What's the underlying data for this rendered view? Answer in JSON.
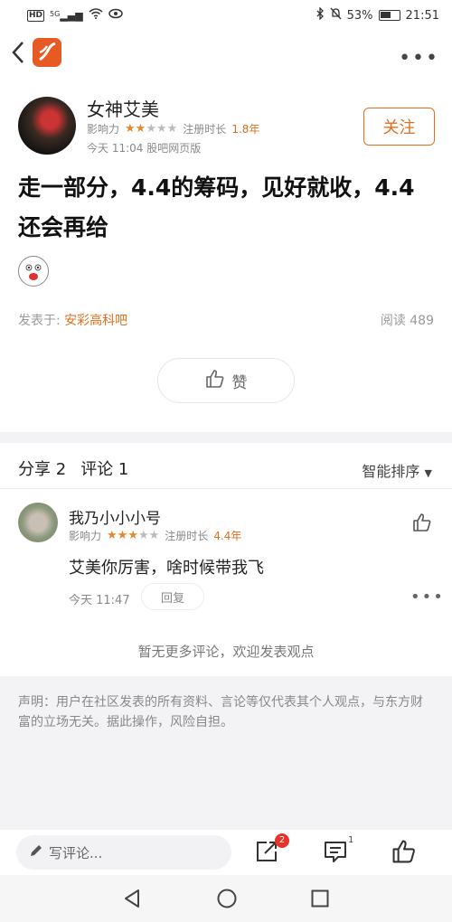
{
  "status_bar": {
    "left_badge": "HD",
    "network": "5G",
    "battery": "53%",
    "time": "21:51"
  },
  "nav": {
    "back_icon": "chevron-left-icon",
    "logo_icon": "app-logo-icon",
    "more_icon": "more-dots-icon"
  },
  "post": {
    "author": "女神艾美",
    "influence_label": "影响力",
    "influence_stars": 2,
    "reg_label": "注册时长",
    "reg_value": "1.8年",
    "timestamp": "今天 11:04 股吧网页版",
    "follow_label": "关注",
    "title": "走一部分，4.4的筹码，见好就收，4.4还会再给",
    "posted_prefix": "发表于:",
    "forum": "安彩高科吧",
    "reads": "阅读 489",
    "like_label": "赞"
  },
  "comments_header": {
    "share": "分享 2",
    "comments": "评论 1",
    "sort": "智能排序"
  },
  "comment": {
    "name": "我乃小小小号",
    "influence_label": "影响力",
    "influence_stars": 3,
    "reg_label": "注册时长",
    "reg_value": "4.4年",
    "text": "艾美你厉害，啥时候带我飞",
    "time": "今天 11:47",
    "reply_label": "回复"
  },
  "no_more": "暂无更多评论，欢迎发表观点",
  "disclaimer": "声明：用户在社区发表的所有资料、言论等仅代表其个人观点，与东方财富的立场无关。据此操作，风险自担。",
  "bottom_bar": {
    "input_placeholder": "写评论...",
    "share_badge": "2",
    "comment_count": "1"
  },
  "colors": {
    "accent": "#e07020",
    "badge": "#e5332a",
    "star_on": "#e08a2c"
  }
}
